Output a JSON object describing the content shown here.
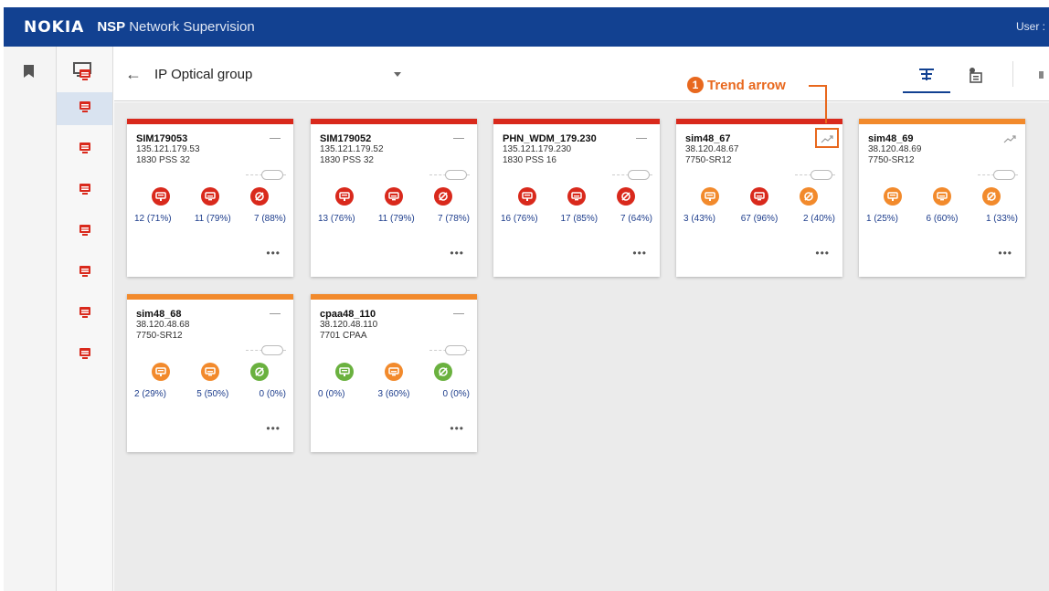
{
  "header": {
    "brand": "NOKIA",
    "product_short": "NSP",
    "product_name": "Network Supervision",
    "user": "User :"
  },
  "toolbar": {
    "title": "IP Optical group"
  },
  "annotation": {
    "number": "1",
    "label": "Trend arrow"
  },
  "colors": {
    "red": "#d9291c",
    "orange": "#f28a2c",
    "green": "#6ab13f",
    "nokia_blue": "#124191"
  },
  "cards": [
    {
      "name": "SIM179053",
      "ip": "135.121.179.53",
      "type": "1830 PSS 32",
      "status": "red",
      "trend": false,
      "icons": [
        "red",
        "red",
        "red"
      ],
      "stats": [
        "12 (71%)",
        "11 (79%)",
        "7 (88%)"
      ]
    },
    {
      "name": "SIM179052",
      "ip": "135.121.179.52",
      "type": "1830 PSS 32",
      "status": "red",
      "trend": false,
      "icons": [
        "red",
        "red",
        "red"
      ],
      "stats": [
        "13 (76%)",
        "11 (79%)",
        "7 (78%)"
      ]
    },
    {
      "name": "PHN_WDM_179.230",
      "ip": "135.121.179.230",
      "type": "1830 PSS 16",
      "status": "red",
      "trend": false,
      "icons": [
        "red",
        "red",
        "red"
      ],
      "stats": [
        "16 (76%)",
        "17 (85%)",
        "7 (64%)"
      ]
    },
    {
      "name": "sim48_67",
      "ip": "38.120.48.67",
      "type": "7750-SR12",
      "status": "red",
      "trend": true,
      "icons": [
        "orange",
        "red",
        "orange"
      ],
      "stats": [
        "3 (43%)",
        "67 (96%)",
        "2 (40%)"
      ]
    },
    {
      "name": "sim48_69",
      "ip": "38.120.48.69",
      "type": "7750-SR12",
      "status": "orange",
      "trend": true,
      "icons": [
        "orange",
        "orange",
        "orange"
      ],
      "stats": [
        "1 (25%)",
        "6 (60%)",
        "1 (33%)"
      ]
    },
    {
      "name": "sim48_68",
      "ip": "38.120.48.68",
      "type": "7750-SR12",
      "status": "orange",
      "trend": false,
      "icons": [
        "orange",
        "orange",
        "green"
      ],
      "stats": [
        "2 (29%)",
        "5 (50%)",
        "0 (0%)"
      ]
    },
    {
      "name": "cpaa48_110",
      "ip": "38.120.48.110",
      "type": "7701 CPAA",
      "status": "orange",
      "trend": false,
      "icons": [
        "green",
        "orange",
        "green"
      ],
      "stats": [
        "0 (0%)",
        "3 (60%)",
        "0 (0%)"
      ]
    }
  ]
}
